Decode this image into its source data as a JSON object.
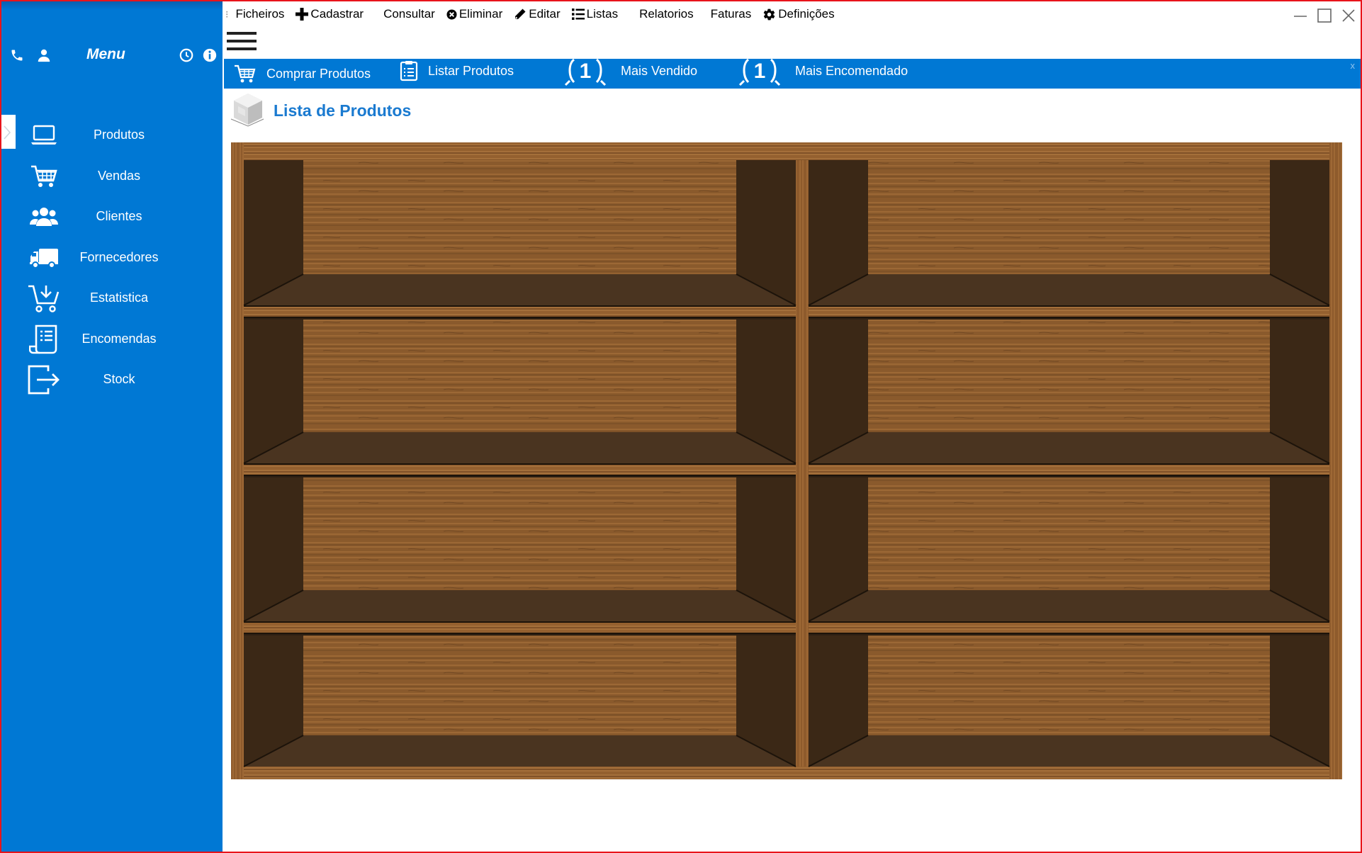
{
  "menubar": {
    "items": [
      {
        "label": "Ficheiros",
        "icon": "none"
      },
      {
        "label": "Cadastrar",
        "icon": "plus-icon"
      },
      {
        "label": "Consultar",
        "icon": "none"
      },
      {
        "label": "Eliminar",
        "icon": "remove-circle-icon"
      },
      {
        "label": "Editar",
        "icon": "pencil-icon"
      },
      {
        "label": "Listas",
        "icon": "list-icon"
      },
      {
        "label": "Relatorios",
        "icon": "none"
      },
      {
        "label": "Faturas",
        "icon": "none"
      },
      {
        "label": "Definições",
        "icon": "gear-icon"
      }
    ]
  },
  "sidebar": {
    "title": "Menu",
    "items": [
      {
        "label": "Produtos",
        "icon": "laptop-icon",
        "active": true
      },
      {
        "label": "Vendas",
        "icon": "shopping-cart-icon"
      },
      {
        "label": "Clientes",
        "icon": "users-icon"
      },
      {
        "label": "Fornecedores",
        "icon": "truck-icon"
      },
      {
        "label": "Estatistica",
        "icon": "cart-download-icon"
      },
      {
        "label": "Encomendas",
        "icon": "document-list-icon"
      },
      {
        "label": "Stock",
        "icon": "export-icon"
      }
    ]
  },
  "toolstrip": {
    "items": [
      {
        "label": "Comprar Produtos",
        "icon": "cart-icon"
      },
      {
        "label": "Listar Produtos",
        "icon": "clipboard-list-icon"
      },
      {
        "label": "Mais Vendido",
        "icon": "laurel-one-icon"
      },
      {
        "label": "Mais Encomendado",
        "icon": "laurel-one-icon"
      }
    ],
    "close": "x"
  },
  "page": {
    "title": "Lista de Produtos"
  },
  "colors": {
    "accent": "#0078d4",
    "title": "#1a7ad0",
    "border": "#e8141b",
    "wood_light": "#8a5a2c",
    "wood_dark": "#3d2a1a"
  }
}
